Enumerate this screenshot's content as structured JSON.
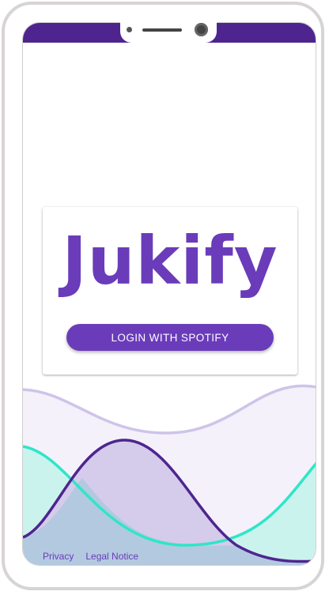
{
  "app": {
    "title": "Jukify",
    "brand_color": "#6a3cba",
    "status_bar_color": "#4e258f",
    "wave_colors": {
      "lavender": "#cec4e8",
      "teal": "#2ee6c7",
      "purple": "#4e258f"
    }
  },
  "login": {
    "button_label": "LOGIN WITH SPOTIFY"
  },
  "footer": {
    "links": [
      {
        "label": "Privacy"
      },
      {
        "label": "Legal Notice"
      }
    ]
  },
  "device": {
    "notch_icons": [
      "sensor-dot-icon",
      "speaker-icon",
      "camera-icon"
    ]
  }
}
